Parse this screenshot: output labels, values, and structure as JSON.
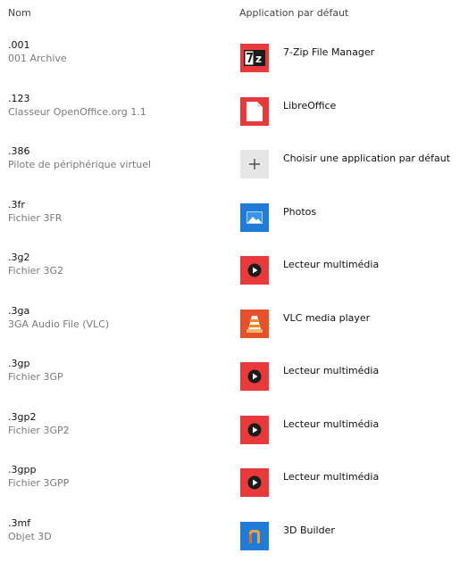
{
  "header": {
    "name_label": "Nom",
    "app_label": "Application par défaut"
  },
  "rows": [
    {
      "ext": ".001",
      "desc": "001 Archive",
      "app": "7-Zip File Manager",
      "icon": "7zip-icon"
    },
    {
      "ext": ".123",
      "desc": "Classeur OpenOffice.org 1.1",
      "app": "LibreOffice",
      "icon": "libreoffice-icon"
    },
    {
      "ext": ".386",
      "desc": "Pilote de périphérique virtuel",
      "app": "Choisir une application par défaut",
      "icon": "plus-icon"
    },
    {
      "ext": ".3fr",
      "desc": "Fichier 3FR",
      "app": "Photos",
      "icon": "photos-icon"
    },
    {
      "ext": ".3g2",
      "desc": "Fichier 3G2",
      "app": "Lecteur multimédia",
      "icon": "media-player-icon"
    },
    {
      "ext": ".3ga",
      "desc": "3GA Audio File (VLC)",
      "app": "VLC media player",
      "icon": "vlc-icon"
    },
    {
      "ext": ".3gp",
      "desc": "Fichier 3GP",
      "app": "Lecteur multimédia",
      "icon": "media-player-icon"
    },
    {
      "ext": ".3gp2",
      "desc": "Fichier 3GP2",
      "app": "Lecteur multimédia",
      "icon": "media-player-icon"
    },
    {
      "ext": ".3gpp",
      "desc": "Fichier 3GPP",
      "app": "Lecteur multimédia",
      "icon": "media-player-icon"
    },
    {
      "ext": ".3mf",
      "desc": "Objet 3D",
      "app": "3D Builder",
      "icon": "3d-builder-icon"
    }
  ],
  "colors": {
    "red_tile": "#e83a3a",
    "blue_tile": "#1f7bd6",
    "grey_tile": "#e6e6e6",
    "vlc_orange": "#f08a1c"
  }
}
